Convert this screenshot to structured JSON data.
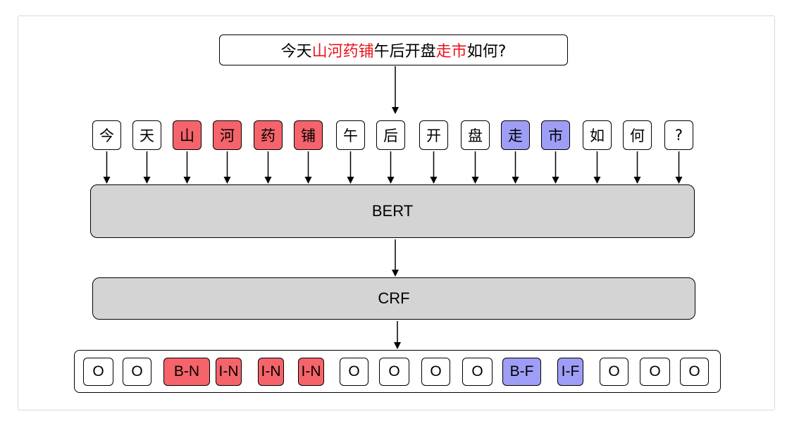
{
  "sentence": {
    "segments": [
      {
        "text": "今天",
        "highlight": false
      },
      {
        "text": "山河药铺",
        "highlight": true
      },
      {
        "text": "午后开盘",
        "highlight": false
      },
      {
        "text": "走市",
        "highlight": true
      },
      {
        "text": "如何?",
        "highlight": false
      }
    ],
    "highlight_color": "#e8141c"
  },
  "tokens": [
    {
      "text": "今",
      "tag": "none"
    },
    {
      "text": "天",
      "tag": "none"
    },
    {
      "text": "山",
      "tag": "entity-n"
    },
    {
      "text": "河",
      "tag": "entity-n"
    },
    {
      "text": "药",
      "tag": "entity-n"
    },
    {
      "text": "铺",
      "tag": "entity-n"
    },
    {
      "text": "午",
      "tag": "none"
    },
    {
      "text": "后",
      "tag": "none"
    },
    {
      "text": "开",
      "tag": "none"
    },
    {
      "text": "盘",
      "tag": "none"
    },
    {
      "text": "走",
      "tag": "entity-f"
    },
    {
      "text": "市",
      "tag": "entity-f"
    },
    {
      "text": "如",
      "tag": "none"
    },
    {
      "text": "何",
      "tag": "none"
    },
    {
      "text": "?",
      "tag": "none"
    }
  ],
  "layers": {
    "encoder_label": "BERT",
    "decoder_label": "CRF"
  },
  "output_labels": [
    {
      "text": "O",
      "tag": "none"
    },
    {
      "text": "O",
      "tag": "none"
    },
    {
      "text": "B-N",
      "tag": "entity-n"
    },
    {
      "text": "I-N",
      "tag": "entity-n"
    },
    {
      "text": "I-N",
      "tag": "entity-n"
    },
    {
      "text": "I-N",
      "tag": "entity-n"
    },
    {
      "text": "O",
      "tag": "none"
    },
    {
      "text": "O",
      "tag": "none"
    },
    {
      "text": "O",
      "tag": "none"
    },
    {
      "text": "O",
      "tag": "none"
    },
    {
      "text": "B-F",
      "tag": "entity-f"
    },
    {
      "text": "I-F",
      "tag": "entity-f"
    },
    {
      "text": "O",
      "tag": "none"
    },
    {
      "text": "O",
      "tag": "none"
    },
    {
      "text": "O",
      "tag": "none"
    }
  ],
  "colors": {
    "entity_n": "#f4646a",
    "entity_f": "#9e9ef7",
    "layer_fill": "#d4d4d4"
  }
}
